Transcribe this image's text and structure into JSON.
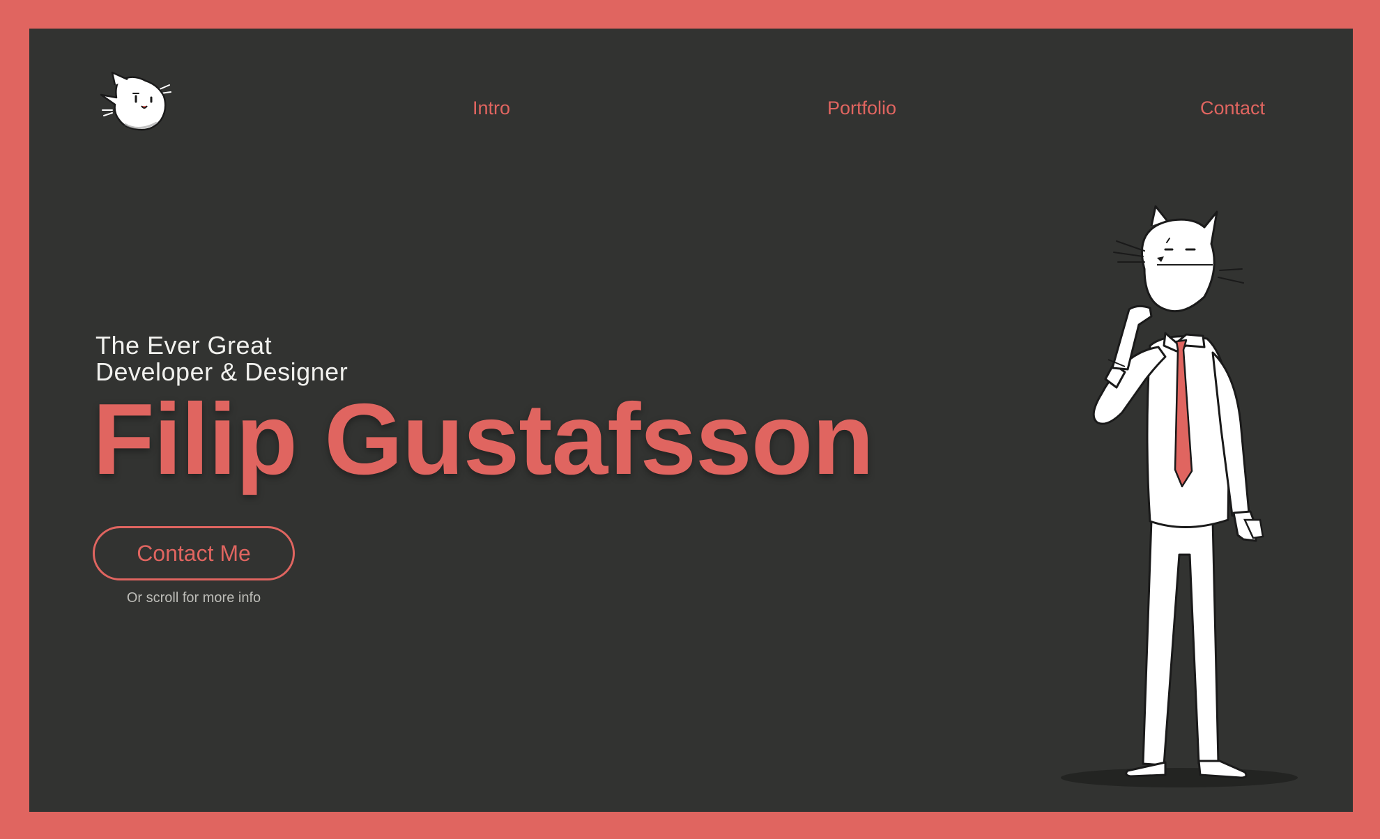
{
  "nav": {
    "intro": "Intro",
    "portfolio": "Portfolio",
    "contact": "Contact"
  },
  "hero": {
    "tagline_line1": "The Ever Great",
    "tagline_line2": "Developer & Designer",
    "name": "Filip Gustafsson",
    "cta_label": "Contact Me",
    "scroll_hint": "Or scroll for more info"
  },
  "icons": {
    "logo": "cat-head-logo-icon",
    "illustration": "cat-character-illustration"
  },
  "colors": {
    "accent": "#e06560",
    "background": "#323331",
    "text_light": "#f1f1ee",
    "text_muted": "#bdbdb8"
  }
}
